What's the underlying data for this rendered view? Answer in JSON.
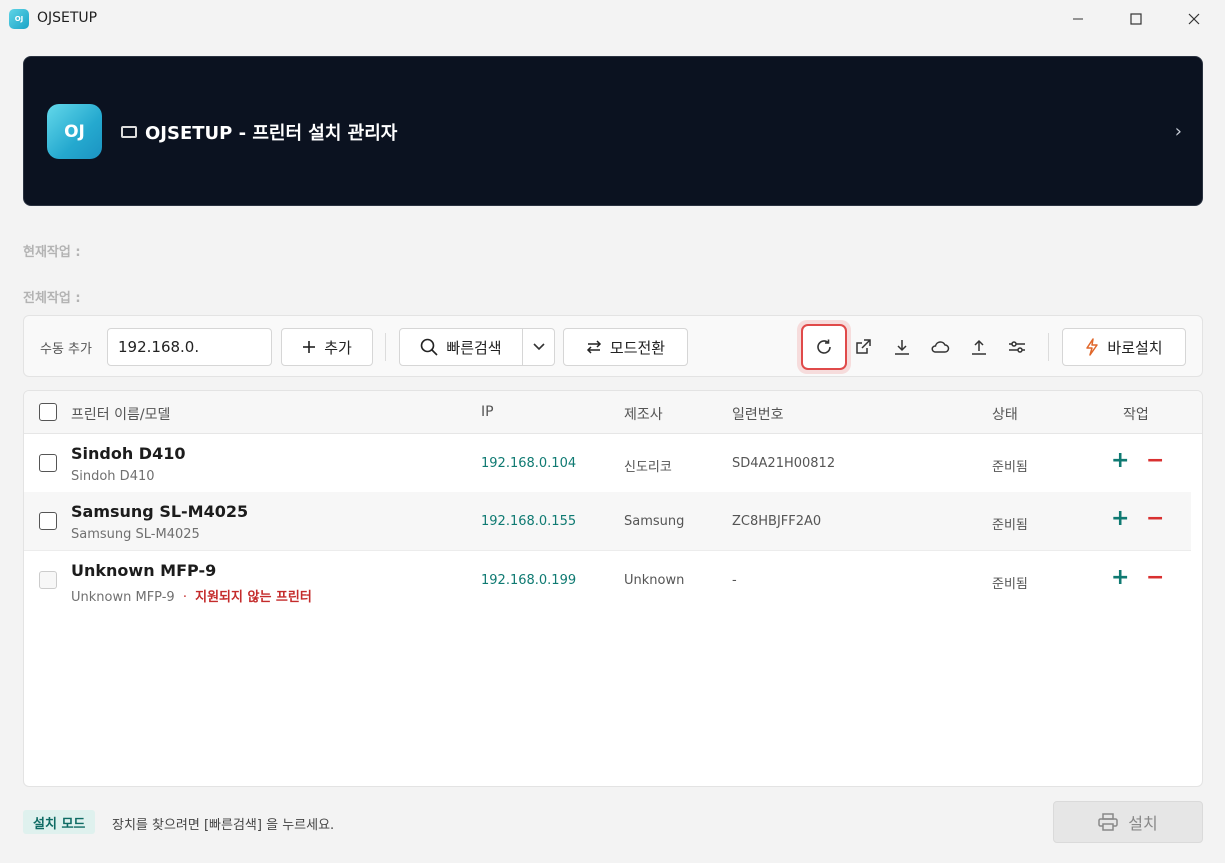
{
  "window": {
    "title": "OJSETUP",
    "app_icon_text": "OJ"
  },
  "banner": {
    "logo_text": "OJ",
    "title": "OJSETUP - 프린터 설치 관리자",
    "chevron": "›"
  },
  "status": {
    "current_label": "현재작업 :",
    "total_label": "전체작업 :"
  },
  "toolbar": {
    "manual_add_label": "수동 추가",
    "ip_input_value": "192.168.0.",
    "add_label": "추가",
    "quick_search_label": "빠른검색",
    "mode_switch_label": "모드전환",
    "quick_install_label": "바로설치",
    "icons": [
      "refresh-icon",
      "external-link-icon",
      "download-icon",
      "cloud-icon",
      "upload-icon",
      "sliders-icon"
    ]
  },
  "table": {
    "headers": {
      "name": "프린터 이름/모델",
      "ip": "IP",
      "maker": "제조사",
      "serial": "일련번호",
      "state": "상태",
      "action": "작업"
    },
    "rows": [
      {
        "name": "Sindoh D410",
        "model": "Sindoh D410",
        "ip": "192.168.0.104",
        "maker": "신도리코",
        "serial": "SD4A21H00812",
        "state": "준비됨"
      },
      {
        "name": "Samsung SL-M4025",
        "model": "Samsung SL-M4025",
        "ip": "192.168.0.155",
        "maker": "Samsung",
        "serial": "ZC8HBJFF2A0",
        "state": "준비됨"
      },
      {
        "name": "Unknown MFP-9",
        "model": "Unknown MFP-9",
        "separator": "·",
        "unsupported": "지원되지 않는 프린터",
        "ip": "192.168.0.199",
        "maker": "Unknown",
        "serial": "-",
        "state": "준비됨"
      }
    ]
  },
  "footer": {
    "mode_badge": "설치 모드",
    "hint": "장치를 찾으려면 [빠른검색] 을 누르세요.",
    "install_label": "설치"
  },
  "colors": {
    "banner_bg": "#0b1220",
    "accent_teal": "#0f7a72",
    "danger_red": "#d93030",
    "highlight_red": "#e04a4a",
    "quick_install_icon": "#e0672a"
  }
}
